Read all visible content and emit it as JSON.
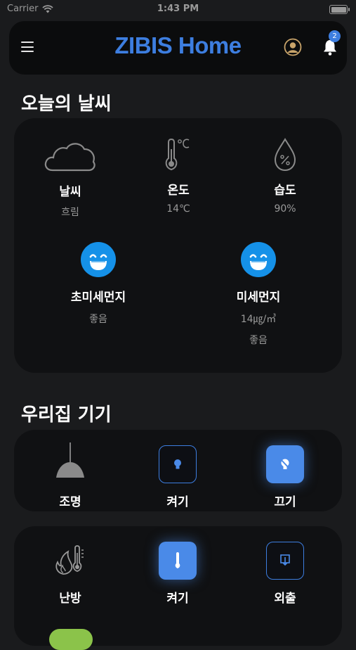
{
  "status_bar": {
    "carrier": "Carrier",
    "time": "1:43 PM"
  },
  "header": {
    "title": "ZIBIS Home",
    "notification_count": "2"
  },
  "weather": {
    "section_title": "오늘의 날씨",
    "items": [
      {
        "label": "날씨",
        "value": "흐림",
        "icon": "cloud-icon"
      },
      {
        "label": "온도",
        "value": "14℃",
        "icon": "thermometer-icon"
      },
      {
        "label": "습도",
        "value": "90%",
        "icon": "humidity-drop-icon"
      }
    ],
    "fine_dust": {
      "label": "초미세먼지",
      "status": "좋음",
      "icon": "smile-face-icon"
    },
    "dust": {
      "label": "미세먼지",
      "value": "14㎍/㎥",
      "status": "좋음",
      "icon": "smile-face-icon"
    }
  },
  "devices": {
    "section_title": "우리집 기기",
    "lighting": {
      "label": "조명",
      "on_label": "켜기",
      "off_label": "끄기",
      "icon": "pendant-lamp-icon"
    },
    "heating": {
      "label": "난방",
      "on_label": "켜기",
      "away_label": "외출",
      "icon": "heating-icon"
    }
  },
  "colors": {
    "accent": "#3d7ee0",
    "face": "#1591e8",
    "background": "#1a1b1d",
    "card": "#101113"
  }
}
